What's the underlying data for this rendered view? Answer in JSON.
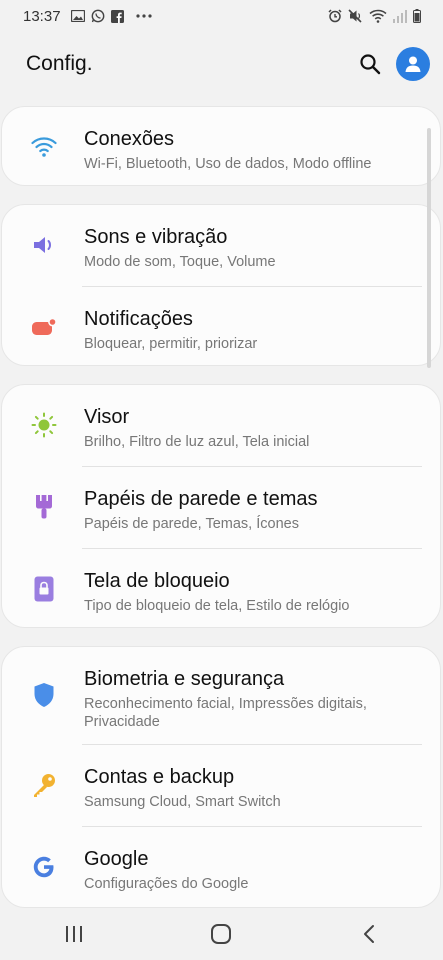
{
  "status_bar": {
    "time": "13:37",
    "left_icons": [
      "image-icon",
      "whatsapp-icon",
      "facebook-icon",
      "more-dots-icon"
    ],
    "right_icons": [
      "alarm-icon",
      "mute-icon",
      "wifi-icon",
      "signal-icon",
      "battery-icon"
    ]
  },
  "header": {
    "title": "Config.",
    "search_icon": "search-icon",
    "account_icon": "account-icon",
    "accent_color": "#2b7ee0"
  },
  "settings_groups": [
    {
      "items": [
        {
          "title": "Conexões",
          "subtitle": "Wi-Fi, Bluetooth, Uso de dados, Modo offline",
          "icon": "wifi-icon",
          "icon_color": "#3a9bdc"
        }
      ]
    },
    {
      "items": [
        {
          "title": "Sons e vibração",
          "subtitle": "Modo de som, Toque, Volume",
          "icon": "volume-icon",
          "icon_color": "#7b6fe0"
        },
        {
          "title": "Notificações",
          "subtitle": "Bloquear, permitir, priorizar",
          "icon": "notification-icon",
          "icon_color": "#ef6a5a"
        }
      ]
    },
    {
      "items": [
        {
          "title": "Visor",
          "subtitle": "Brilho, Filtro de luz azul, Tela inicial",
          "icon": "brightness-icon",
          "icon_color": "#8fc63a"
        },
        {
          "title": "Papéis de parede e temas",
          "subtitle": "Papéis de parede, Temas, Ícones",
          "icon": "paintbrush-icon",
          "icon_color": "#a46ad6"
        },
        {
          "title": "Tela de bloqueio",
          "subtitle": "Tipo de bloqueio de tela, Estilo de relógio",
          "icon": "lock-icon",
          "icon_color": "#9a7ee0"
        }
      ]
    },
    {
      "items": [
        {
          "title": "Biometria e segurança",
          "subtitle": "Reconhecimento facial, Impressões digitais, Privacidade",
          "icon": "shield-icon",
          "icon_color": "#4a8ee8"
        },
        {
          "title": "Contas e backup",
          "subtitle": "Samsung Cloud, Smart Switch",
          "icon": "key-icon",
          "icon_color": "#f2b230"
        },
        {
          "title": "Google",
          "subtitle": "Configurações do Google",
          "icon": "google-icon",
          "icon_color": "#4a7fe0"
        }
      ]
    }
  ],
  "nav_bar": {
    "recents": "recents-icon",
    "home": "home-icon",
    "back": "back-icon"
  }
}
